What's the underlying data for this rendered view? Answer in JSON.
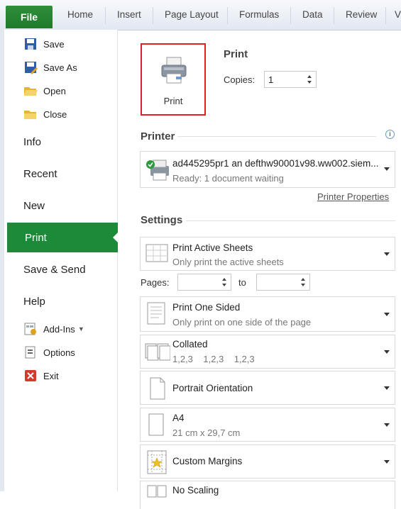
{
  "ribbon": {
    "file_tab": "File",
    "tabs": [
      "Home",
      "Insert",
      "Page Layout",
      "Formulas",
      "Data",
      "Review",
      "V"
    ]
  },
  "backstage_nav": {
    "quick_items": [
      {
        "label": "Save",
        "icon": "save-icon"
      },
      {
        "label": "Save As",
        "icon": "save-as-icon"
      },
      {
        "label": "Open",
        "icon": "open-folder-icon"
      },
      {
        "label": "Close",
        "icon": "close-folder-icon"
      }
    ],
    "info": "Info",
    "recent": "Recent",
    "new": "New",
    "print": "Print",
    "save_send": "Save & Send",
    "help": "Help",
    "addins": "Add-Ins",
    "options": "Options",
    "exit": "Exit"
  },
  "print_section": {
    "heading": "Print",
    "button_label": "Print",
    "copies_label": "Copies:",
    "copies_value": "1"
  },
  "printer_section": {
    "heading": "Printer",
    "printer_name": "ad445295pr1 an defthw90001v98.ww002.siem...",
    "printer_status": "Ready: 1 document waiting",
    "properties_link": "Printer Properties"
  },
  "settings_section": {
    "heading": "Settings",
    "active_sheets": {
      "title": "Print Active Sheets",
      "subtitle": "Only print the active sheets"
    },
    "pages_label": "Pages:",
    "to_label": "to",
    "sides": {
      "title": "Print One Sided",
      "subtitle": "Only print on one side of the page"
    },
    "collation": {
      "title": "Collated",
      "subtitle": "1,2,3    1,2,3    1,2,3"
    },
    "orientation": {
      "title": "Portrait Orientation"
    },
    "paper": {
      "title": "A4",
      "subtitle": "21 cm x 29,7 cm"
    },
    "margins": {
      "title": "Custom Margins"
    },
    "scaling": {
      "title": "No Scaling"
    }
  },
  "colors": {
    "accent": "#1d8a3a",
    "highlight_border": "#e02020"
  }
}
